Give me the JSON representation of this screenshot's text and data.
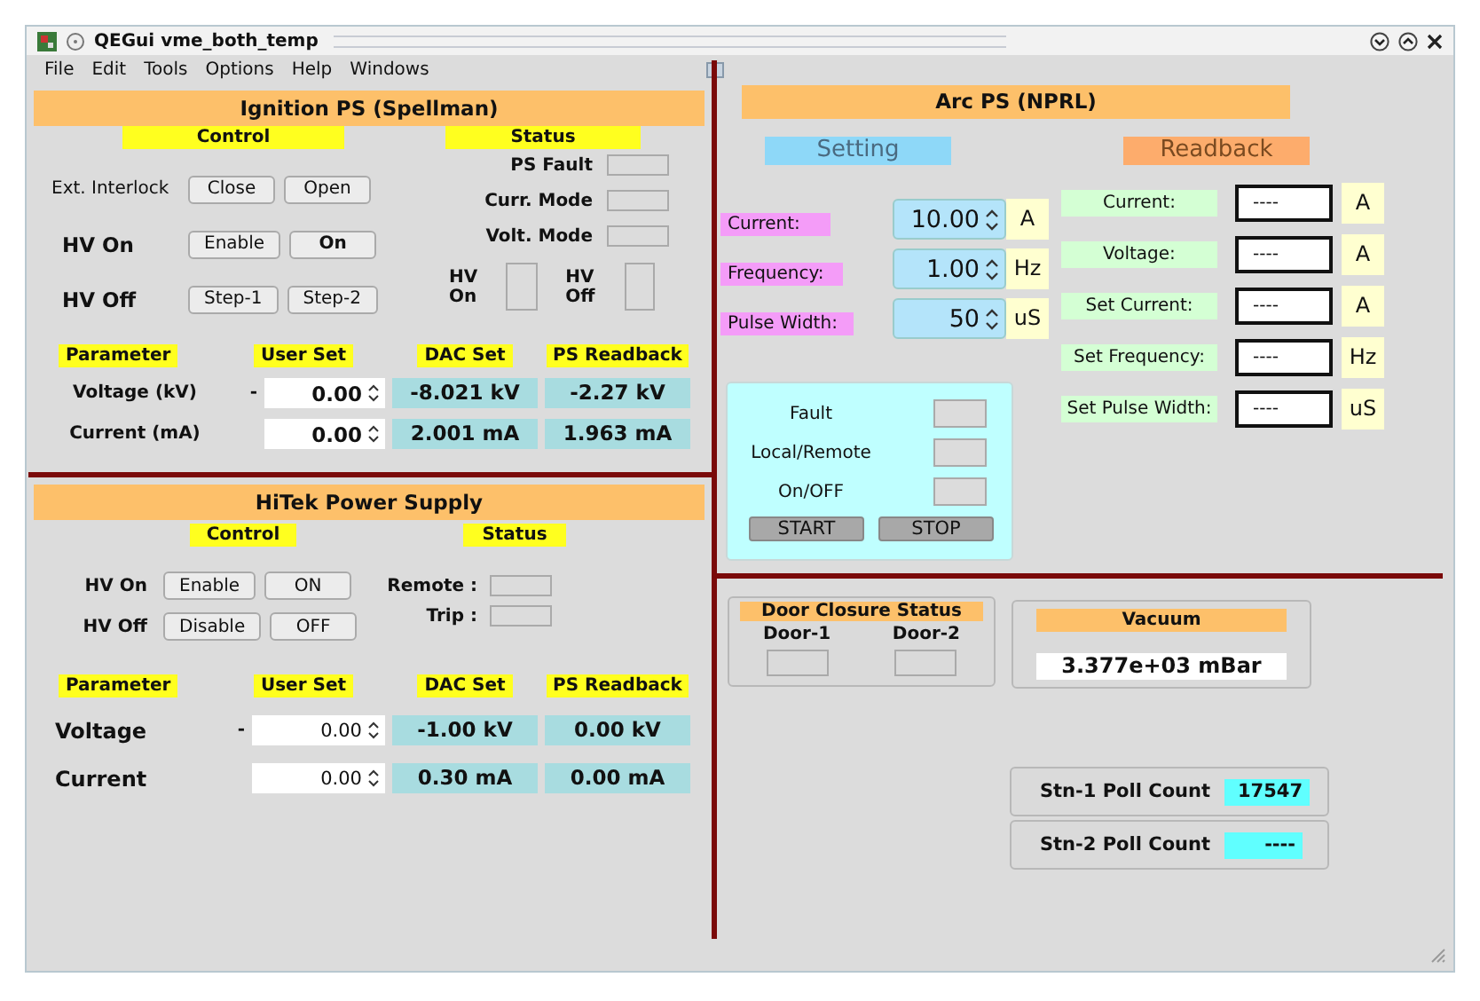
{
  "window": {
    "title": "QEGui vme_both_temp"
  },
  "menu": [
    "File",
    "Edit",
    "Tools",
    "Options",
    "Help",
    "Windows"
  ],
  "ignition": {
    "title": "Ignition PS (Spellman)",
    "control_label": "Control",
    "status_label": "Status",
    "controls": [
      {
        "label": "Ext. Interlock",
        "kind": "plain",
        "buttons": [
          "Close",
          "Open"
        ]
      },
      {
        "label": "HV On",
        "kind": "bold",
        "buttons": [
          "Enable",
          "On"
        ]
      },
      {
        "label": "HV Off",
        "kind": "bold",
        "buttons": [
          "Step-1",
          "Step-2"
        ]
      }
    ],
    "status": [
      "PS Fault",
      "Curr. Mode",
      "Volt. Mode"
    ],
    "indicators": [
      "HV On",
      "HV Off"
    ],
    "headers": [
      "Parameter",
      "User Set",
      "DAC Set",
      "PS Readback"
    ],
    "rows": [
      {
        "name": "Voltage (kV)",
        "sign": "-",
        "user_set": "0.00",
        "dac_set": "-8.021 kV",
        "readback": "-2.27 kV"
      },
      {
        "name": "Current (mA)",
        "user_set": "0.00",
        "dac_set": "2.001 mA",
        "readback": "1.963 mA"
      }
    ]
  },
  "hitek": {
    "title": "HiTek Power Supply",
    "control_label": "Control",
    "status_label": "Status",
    "controls": [
      {
        "label": "HV On",
        "kind": "bold",
        "buttons": [
          "Enable",
          "ON"
        ]
      },
      {
        "label": "HV Off",
        "kind": "bold",
        "buttons": [
          "Disable",
          "OFF"
        ]
      }
    ],
    "status": [
      "Remote :",
      "Trip :"
    ],
    "headers": [
      "Parameter",
      "User Set",
      "DAC Set",
      "PS Readback"
    ],
    "rows": [
      {
        "name": "Voltage",
        "sign": "-",
        "user_set": "0.00",
        "dac_set": "-1.00 kV",
        "readback": "0.00 kV"
      },
      {
        "name": "Current",
        "user_set": "0.00",
        "dac_set": "0.30 mA",
        "readback": "0.00 mA"
      }
    ]
  },
  "arc": {
    "title": "Arc PS (NPRL)",
    "setting_label": "Setting",
    "readback_label": "Readback",
    "settings": [
      {
        "label": "Current:",
        "value": "10.00",
        "unit": "A"
      },
      {
        "label": "Frequency:",
        "value": "1.00",
        "unit": "Hz"
      },
      {
        "label": "Pulse Width:",
        "value": "50",
        "unit": "uS"
      }
    ],
    "readbacks": [
      {
        "label": "Current:",
        "value": "----",
        "unit": "A"
      },
      {
        "label": "Voltage:",
        "value": "----",
        "unit": "A"
      },
      {
        "label": "Set Current:",
        "value": "----",
        "unit": "A"
      },
      {
        "label": "Set Frequency:",
        "value": "----",
        "unit": "Hz"
      },
      {
        "label": "Set Pulse Width:",
        "value": "----",
        "unit": "uS"
      }
    ],
    "status": [
      "Fault",
      "Local/Remote",
      "On/OFF"
    ],
    "buttons": [
      "START",
      "STOP"
    ]
  },
  "doors": {
    "title": "Door Closure Status",
    "doors": [
      "Door-1",
      "Door-2"
    ]
  },
  "vacuum": {
    "title": "Vacuum",
    "value": "3.377e+03 mBar"
  },
  "poll": [
    {
      "label": "Stn-1 Poll Count",
      "value": "17547"
    },
    {
      "label": "Stn-2 Poll Count",
      "value": "----"
    }
  ]
}
